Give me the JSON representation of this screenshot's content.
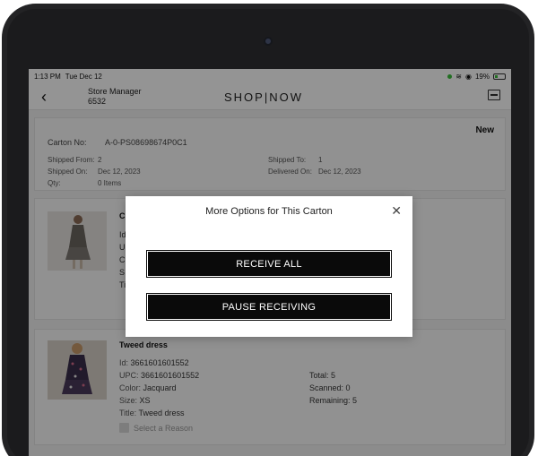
{
  "status_bar": {
    "time": "1:13 PM",
    "date": "Tue Dec 12",
    "battery": "19%"
  },
  "header": {
    "back_icon": "chevron-left-icon",
    "store_role": "Store Manager",
    "store_number": "6532",
    "brand": "SHOP|NOW",
    "scanner_icon": "barcode-scanner-icon"
  },
  "carton": {
    "status": "New",
    "carton_no_label": "Carton No:",
    "carton_no": "A-0-PS08698674P0C1",
    "shipped_from_label": "Shipped From:",
    "shipped_from": "2",
    "shipped_to_label": "Shipped To:",
    "shipped_to": "1",
    "shipped_on_label": "Shipped On:",
    "shipped_on": "Dec 12, 2023",
    "delivered_on_label": "Delivered On:",
    "delivered_on": "Dec 12, 2023",
    "qty_label": "Qty:",
    "qty": "0 Items"
  },
  "product_1_partial": {
    "title_start": "C",
    "id_start": "Id",
    "upc_start": "U",
    "color_start": "C",
    "size_start": "S",
    "title_line_start": "Ti"
  },
  "product_2": {
    "name": "Tweed dress",
    "id_label": "Id:",
    "id": "3661601601552",
    "upc_label": "UPC:",
    "upc": "3661601601552",
    "color_label": "Color:",
    "color": "Jacquard",
    "size_label": "Size:",
    "size": "XS",
    "title_label": "Title:",
    "title": "Tweed dress",
    "total_label": "Total:",
    "total": "5",
    "scanned_label": "Scanned:",
    "scanned": "0",
    "remaining_label": "Remaining:",
    "remaining": "5",
    "reason_placeholder": "Select a Reason"
  },
  "modal": {
    "title": "More Options for This Carton",
    "close_icon": "close-icon",
    "receive_all": "RECEIVE ALL",
    "pause_receiving": "PAUSE RECEIVING"
  },
  "colors": {
    "button_bg": "#0a0a0a",
    "overlay": "rgba(0,0,0,0.42)",
    "battery_green": "#3bbf3b"
  }
}
